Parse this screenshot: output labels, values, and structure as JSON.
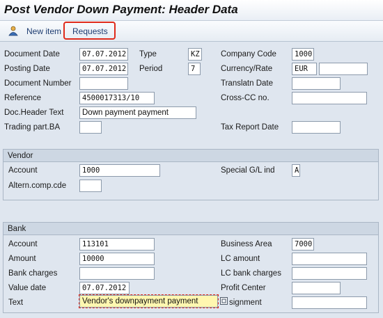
{
  "window": {
    "title": "Post Vendor Down Payment: Header Data"
  },
  "toolbar": {
    "new_item": {
      "label": "New item",
      "icon": "person-icon"
    },
    "requests": {
      "label": "Requests"
    }
  },
  "header": {
    "document_date": {
      "label": "Document Date",
      "value": "07.07.2012"
    },
    "type": {
      "label": "Type",
      "value": "KZ"
    },
    "company_code": {
      "label": "Company Code",
      "value": "1000"
    },
    "posting_date": {
      "label": "Posting Date",
      "value": "07.07.2012"
    },
    "period": {
      "label": "Period",
      "value": "7"
    },
    "currency_rate": {
      "label": "Currency/Rate",
      "currency": "EUR",
      "rate": ""
    },
    "document_number": {
      "label": "Document Number",
      "value": ""
    },
    "translatn_date": {
      "label": "Translatn Date",
      "value": ""
    },
    "reference": {
      "label": "Reference",
      "value": "4500017313/10"
    },
    "cross_cc": {
      "label": "Cross-CC no.",
      "value": ""
    },
    "doc_header_text": {
      "label": "Doc.Header Text",
      "value": "Down payment payment"
    },
    "trading_part": {
      "label": "Trading part.BA",
      "value": ""
    },
    "tax_report_date": {
      "label": "Tax Report Date",
      "value": ""
    }
  },
  "vendor": {
    "title": "Vendor",
    "account": {
      "label": "Account",
      "value": "1000"
    },
    "special_gl": {
      "label": "Special G/L ind",
      "value": "A"
    },
    "altern_comp": {
      "label": "Altern.comp.cde",
      "value": ""
    }
  },
  "bank": {
    "title": "Bank",
    "account": {
      "label": "Account",
      "value": "113101"
    },
    "business_area": {
      "label": "Business Area",
      "value": "7000"
    },
    "amount": {
      "label": "Amount",
      "value": "10000"
    },
    "lc_amount": {
      "label": "LC amount",
      "value": ""
    },
    "bank_charges": {
      "label": "Bank charges",
      "value": ""
    },
    "lc_bank_charges": {
      "label": "LC bank charges",
      "value": ""
    },
    "value_date": {
      "label": "Value date",
      "value": "07.07.2012"
    },
    "profit_center": {
      "label": "Profit Center",
      "value": ""
    },
    "text": {
      "label": "Text",
      "value": "Vendor's downpayment payment"
    },
    "assignment": {
      "label": "signment",
      "value": ""
    }
  },
  "colors": {
    "highlight": "#e02a1a",
    "active_field_bg": "#fff7b0",
    "background": "#dfe6ef"
  }
}
